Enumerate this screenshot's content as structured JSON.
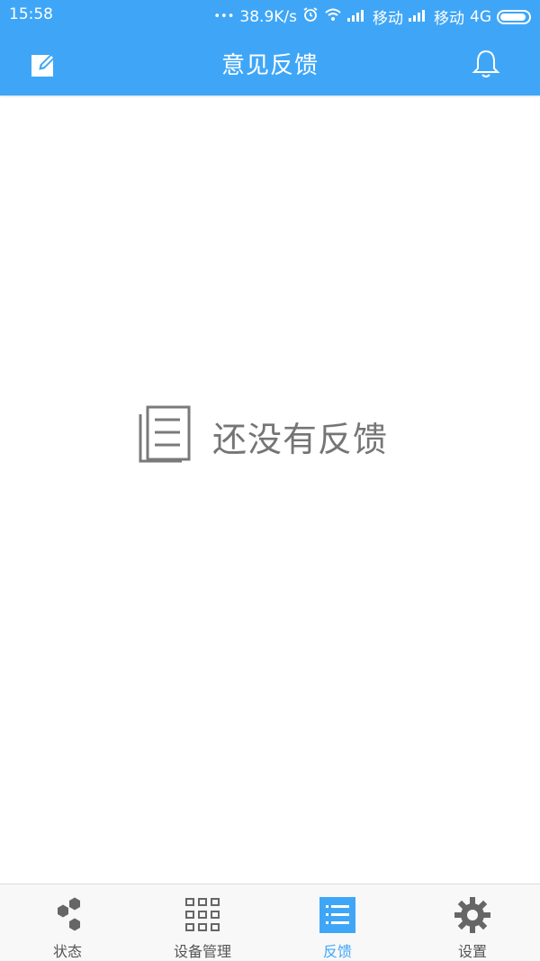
{
  "status_bar": {
    "time": "15:58",
    "dots": "•••",
    "speed": "38.9K/s",
    "carrier1": "移动",
    "carrier2": "移动",
    "network": "4G",
    "icons": [
      "alarm-icon",
      "wifi-icon",
      "signal-icon",
      "signal-icon",
      "battery-icon"
    ]
  },
  "app_bar": {
    "title": "意见反馈",
    "left_icon": "edit-icon",
    "right_icon": "bell-icon"
  },
  "empty_state": {
    "icon": "document-list-icon",
    "message": "还没有反馈"
  },
  "bottom_nav": {
    "items": [
      {
        "label": "状态",
        "icon": "hexagons-icon",
        "active": false
      },
      {
        "label": "设备管理",
        "icon": "grid-icon",
        "active": false
      },
      {
        "label": "反馈",
        "icon": "list-icon",
        "active": true
      },
      {
        "label": "设置",
        "icon": "gear-icon",
        "active": false
      }
    ]
  },
  "colors": {
    "primary": "#3fa6f7",
    "inactive": "#666666",
    "empty_text": "#757575"
  }
}
